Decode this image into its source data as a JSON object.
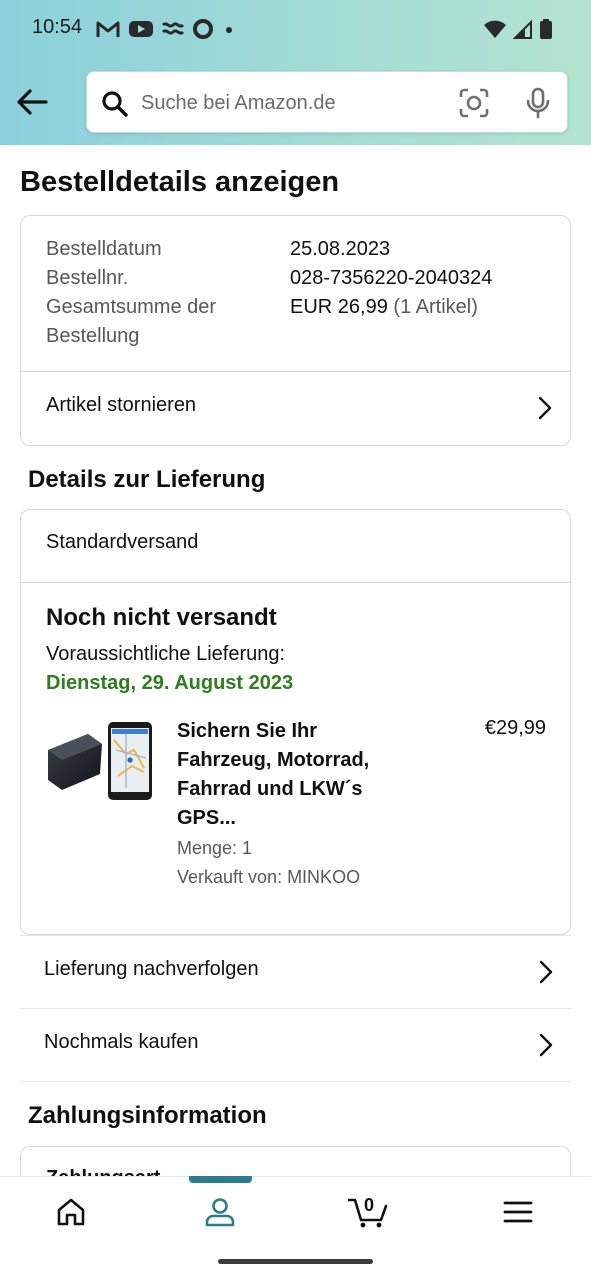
{
  "status_bar": {
    "time": "10:54",
    "left_icons": [
      "gmail-icon",
      "youtube-icon",
      "wave-icon",
      "circle-icon",
      "dot-icon"
    ],
    "right_icons": [
      "wifi-icon",
      "signal-icon",
      "battery-icon"
    ]
  },
  "header": {
    "search_placeholder": "Suche bei Amazon.de"
  },
  "page": {
    "title": "Bestelldetails anzeigen"
  },
  "order": {
    "date_label": "Bestelldatum",
    "date_value": "25.08.2023",
    "number_label": "Bestellnr.",
    "number_value": "028-7356220-2040324",
    "total_label_line1": "Gesamtsumme der",
    "total_label_line2": "Bestellung",
    "total_value": "EUR 26,99",
    "total_items": "(1 Artikel)",
    "cancel_label": "Artikel stornieren"
  },
  "delivery": {
    "section_title": "Details zur Lieferung",
    "ship_method": "Standardversand",
    "status": "Noch nicht versandt",
    "estimate_label": "Voraussichtliche Lieferung:",
    "estimate_date": "Dienstag, 29. August 2023",
    "product": {
      "title": "Sichern Sie Ihr Fahrzeug, Motorrad, Fahrrad und LKW´s GPS...",
      "price": "€29,99",
      "quantity": "Menge: 1",
      "seller": "Verkauft von: MINKOO"
    },
    "track_label": "Lieferung nachverfolgen",
    "buy_again_label": "Nochmals kaufen"
  },
  "payment": {
    "section_title": "Zahlungsinformation",
    "method_label": "Zahlungsart"
  },
  "bottom_nav": {
    "cart_count": "0",
    "active_tab": "profile",
    "accent_color": "#2b7c8e"
  },
  "colors": {
    "delivery_green": "#2e7d1f",
    "header_gradient_start": "#8ad0dc",
    "header_gradient_end": "#b4e4cf"
  }
}
